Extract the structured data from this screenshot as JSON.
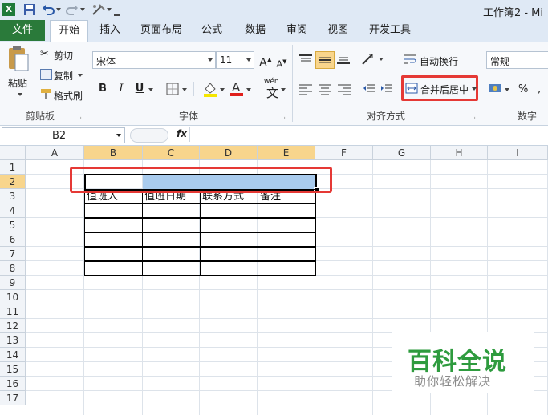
{
  "window": {
    "title": "工作簿2 - Mi"
  },
  "quick_access": {
    "icons": [
      "excel-logo-icon",
      "save-icon",
      "undo-icon",
      "redo-icon",
      "tools-icon",
      "customize-icon"
    ]
  },
  "tabs": [
    "文件",
    "开始",
    "插入",
    "页面布局",
    "公式",
    "数据",
    "审阅",
    "视图",
    "开发工具"
  ],
  "clipboard": {
    "paste": "粘贴",
    "cut": "剪切",
    "copy": "复制",
    "format_painter": "格式刷",
    "group": "剪贴板"
  },
  "font": {
    "name": "宋体",
    "size": "11",
    "bold": "B",
    "italic": "I",
    "underline": "U",
    "group": "字体",
    "grow": "A",
    "shrink": "A",
    "wen": "wén",
    "wen_char": "文"
  },
  "alignment": {
    "wrap": "自动换行",
    "merge": "合并后居中",
    "group": "对齐方式"
  },
  "number": {
    "format": "常规",
    "percent": "%",
    "group": "数字"
  },
  "formula_bar": {
    "name_box": "B2",
    "fx": "fx"
  },
  "colors": {
    "file_tab": "#2a7a3a",
    "highlight": "#e53935",
    "selection": "#a9cbed",
    "header_sel": "#f8d58c"
  },
  "grid": {
    "columns": [
      "A",
      "B",
      "C",
      "D",
      "E",
      "F",
      "G",
      "H",
      "I"
    ],
    "rows": [
      "1",
      "2",
      "3",
      "4",
      "5",
      "6",
      "7",
      "8",
      "9",
      "10",
      "11",
      "12",
      "13",
      "14",
      "15",
      "16",
      "17"
    ],
    "row3": [
      "值班人",
      "值班日期",
      "联系方式",
      "备注"
    ]
  },
  "watermark": {
    "title": "百科全说",
    "subtitle": "助你轻松解决"
  }
}
